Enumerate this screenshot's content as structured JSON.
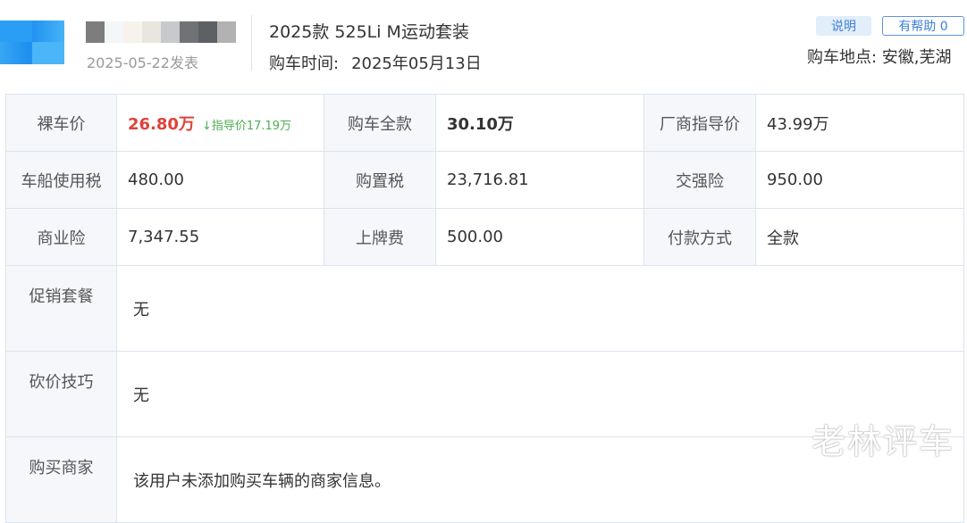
{
  "header": {
    "post_date": "2025-05-22发表",
    "car_model": "2025款 525Li M运动套装",
    "purchase_time_label": "购车时间:",
    "purchase_time_value": "2025年05月13日",
    "explain_label": "说明",
    "helpful_label": "有帮助 0",
    "location": "购车地点: 安徽,芜湖",
    "username_colors": [
      "#7d7d7d",
      "#f3f7f8",
      "#f7f3ec",
      "#e9e6df",
      "#c8c9cc",
      "#707278",
      "#5d6065",
      "#b2b2b2"
    ]
  },
  "table": {
    "row1": {
      "bare_price_label": "裸车价",
      "bare_price_value": "26.80万",
      "guide_note": "↓指导价17.19万",
      "total_label": "购车全款",
      "total_value": "30.10万",
      "msrp_label": "厂商指导价",
      "msrp_value": "43.99万"
    },
    "row2": {
      "vessel_tax_label": "车船使用税",
      "vessel_tax_value": "480.00",
      "purchase_tax_label": "购置税",
      "purchase_tax_value": "23,716.81",
      "compulsory_ins_label": "交强险",
      "compulsory_ins_value": "950.00"
    },
    "row3": {
      "commercial_ins_label": "商业险",
      "commercial_ins_value": "7,347.55",
      "plate_fee_label": "上牌费",
      "plate_fee_value": "500.00",
      "payment_label": "付款方式",
      "payment_value": "全款"
    },
    "promo_label": "促销套餐",
    "promo_value": "无",
    "bargain_label": "砍价技巧",
    "bargain_value": "无",
    "dealer_label": "购买商家",
    "dealer_value": "该用户未添加购买车辆的商家信息。"
  },
  "watermark": "老林评车",
  "colors": {
    "accent_red": "#e0413a",
    "accent_blue": "#3d7fd8",
    "guide_green": "#4caf50"
  }
}
